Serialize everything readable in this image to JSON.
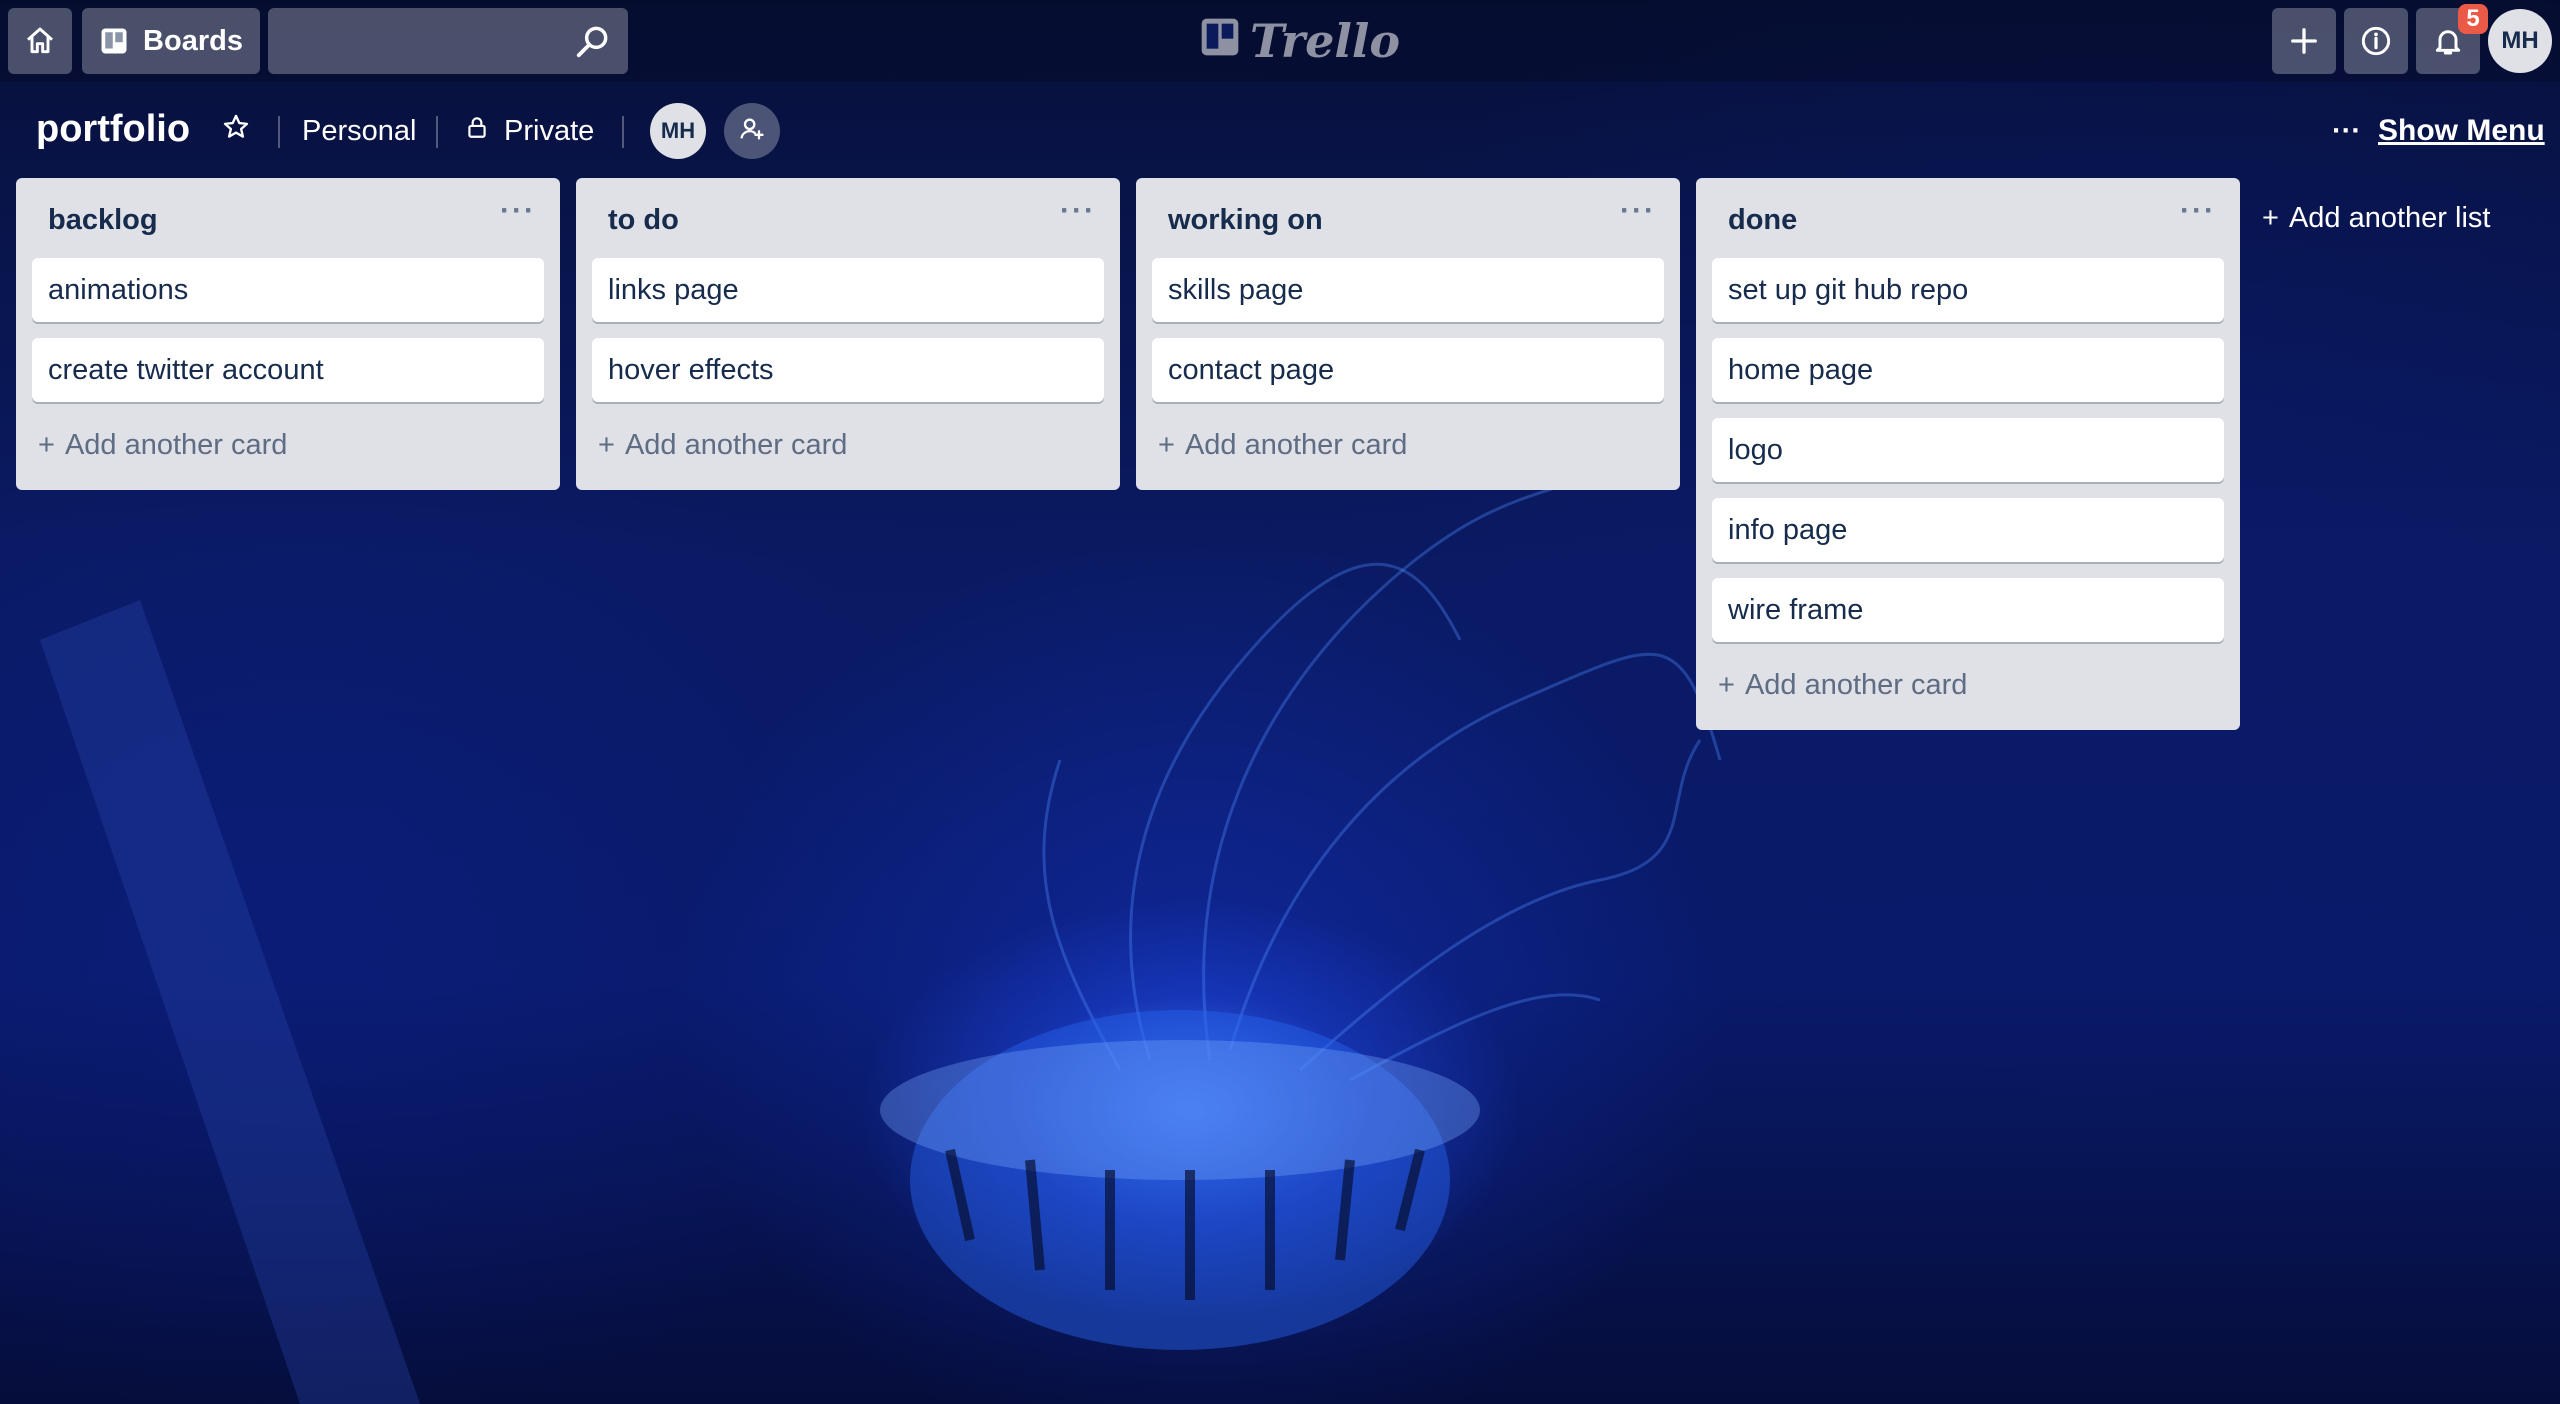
{
  "header": {
    "home_icon": "home-icon",
    "boards_label": "Boards",
    "search_placeholder": "",
    "search_icon": "search-icon",
    "logo_text": "Trello",
    "notification_count": "5",
    "user_initials": "MH"
  },
  "board": {
    "title": "portfolio",
    "team": "Personal",
    "visibility": "Private",
    "member_initials": "MH",
    "show_menu_label": "Show Menu"
  },
  "lists": [
    {
      "title": "backlog",
      "cards": [
        "animations",
        "create twitter account"
      ],
      "add_card_label": "Add another card"
    },
    {
      "title": "to do",
      "cards": [
        "links page",
        "hover effects"
      ],
      "add_card_label": "Add another card"
    },
    {
      "title": "working on",
      "cards": [
        "skills page",
        "contact page"
      ],
      "add_card_label": "Add another card"
    },
    {
      "title": "done",
      "cards": [
        "set up git hub repo",
        "home page",
        "logo",
        "info page",
        "wire frame"
      ],
      "add_card_label": "Add another card"
    }
  ],
  "add_list_label": "Add another list",
  "colors": {
    "list_bg": "#dfe1e6",
    "card_bg": "#ffffff",
    "badge": "#eb5a46",
    "background": "#0a1a62"
  }
}
